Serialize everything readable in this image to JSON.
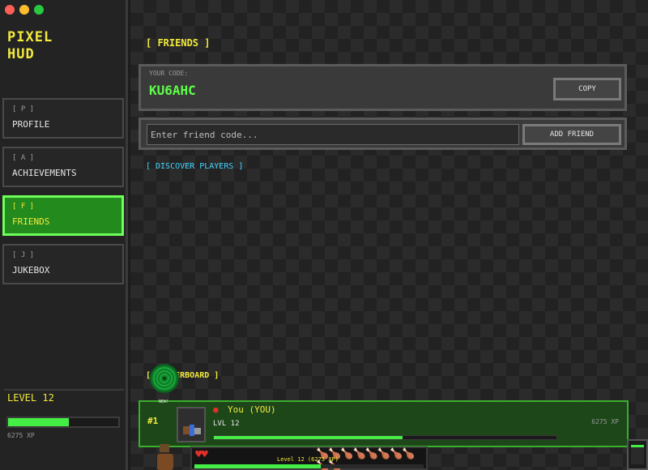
{
  "app": {
    "title_line1": "PIXEL",
    "title_line2": "HUD"
  },
  "sidebar": {
    "items": [
      {
        "key": "[ P ]",
        "label": "PROFILE"
      },
      {
        "key": "[ A ]",
        "label": "ACHIEVEMENTS"
      },
      {
        "key": "[ F ]",
        "label": "FRIENDS",
        "active": true
      },
      {
        "key": "[ J ]",
        "label": "JUKEBOX"
      }
    ],
    "level_label": "LEVEL 12",
    "xp_text": "6275 XP",
    "xp_progress": 0.55
  },
  "friends": {
    "title": "[ FRIENDS ]",
    "code_caption": "YOUR CODE:",
    "code": "KU6AHC",
    "copy_label": "COPY",
    "input_placeholder": "Enter friend code...",
    "add_label": "ADD FRIEND",
    "discover_label": "[ DISCOVER PLAYERS ]"
  },
  "leaderboard": {
    "title": "[ LEADERBOARD ]",
    "new_tag": "NEW!",
    "rows": [
      {
        "rank": "#1",
        "name": "You (YOU)",
        "level": "LVL 12",
        "xp": "6275 XP",
        "progress": 0.55
      }
    ]
  },
  "hud": {
    "label": "Level 12  (6275 XP)",
    "hearts": "♥♥",
    "hunger": "🍗🍗🍗🍗🍗🍗🍗🍗🍗🍗",
    "progress": 0.55
  },
  "colors": {
    "accent_yellow": "#f2ea3d",
    "accent_green": "#44ee44",
    "active_nav": "#238a1e",
    "link_cyan": "#44d6ff"
  }
}
